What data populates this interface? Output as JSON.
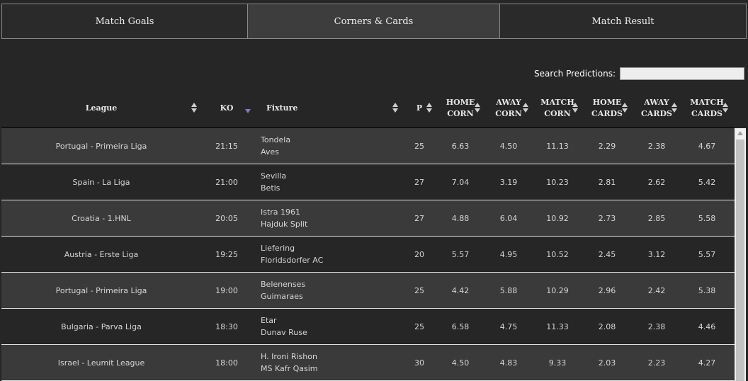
{
  "tabs": [
    {
      "label": "Match Goals",
      "active": false
    },
    {
      "label": "Corners & Cards",
      "active": true
    },
    {
      "label": "Match Result",
      "active": false
    }
  ],
  "search": {
    "label": "Search Predictions:",
    "value": ""
  },
  "columns": {
    "league": "League",
    "ko": "KO",
    "fixture": "Fixture",
    "p": "P",
    "home_corn_1": "HOME",
    "home_corn_2": "CORN",
    "away_corn_1": "AWAY",
    "away_corn_2": "CORN",
    "match_corn_1": "MATCH",
    "match_corn_2": "CORN",
    "home_cards_1": "HOME",
    "home_cards_2": "CARDS",
    "away_cards_1": "AWAY",
    "away_cards_2": "CARDS",
    "match_cards_1": "MATCH",
    "match_cards_2": "CARDS"
  },
  "rows": [
    {
      "league": "Portugal - Primeira Liga",
      "ko": "21:15",
      "home": "Tondela",
      "away": "Aves",
      "p": "25",
      "hc": "6.63",
      "ac": "4.50",
      "mc": "11.13",
      "hca": "2.29",
      "aca": "2.38",
      "mca": "4.67"
    },
    {
      "league": "Spain - La Liga",
      "ko": "21:00",
      "home": "Sevilla",
      "away": "Betis",
      "p": "27",
      "hc": "7.04",
      "ac": "3.19",
      "mc": "10.23",
      "hca": "2.81",
      "aca": "2.62",
      "mca": "5.42"
    },
    {
      "league": "Croatia - 1.HNL",
      "ko": "20:05",
      "home": "Istra 1961",
      "away": "Hajduk Split",
      "p": "27",
      "hc": "4.88",
      "ac": "6.04",
      "mc": "10.92",
      "hca": "2.73",
      "aca": "2.85",
      "mca": "5.58"
    },
    {
      "league": "Austria - Erste Liga",
      "ko": "19:25",
      "home": "Liefering",
      "away": "Floridsdorfer AC",
      "p": "20",
      "hc": "5.57",
      "ac": "4.95",
      "mc": "10.52",
      "hca": "2.45",
      "aca": "3.12",
      "mca": "5.57"
    },
    {
      "league": "Portugal - Primeira Liga",
      "ko": "19:00",
      "home": "Belenenses",
      "away": "Guimaraes",
      "p": "25",
      "hc": "4.42",
      "ac": "5.88",
      "mc": "10.29",
      "hca": "2.96",
      "aca": "2.42",
      "mca": "5.38"
    },
    {
      "league": "Bulgaria - Parva Liga",
      "ko": "18:30",
      "home": "Etar",
      "away": "Dunav Ruse",
      "p": "25",
      "hc": "6.58",
      "ac": "4.75",
      "mc": "11.33",
      "hca": "2.08",
      "aca": "2.38",
      "mca": "4.46"
    },
    {
      "league": "Israel - Leumit League",
      "ko": "18:00",
      "home": "H. Ironi Rishon",
      "away": "MS Kafr Qasim",
      "p": "30",
      "hc": "4.50",
      "ac": "4.83",
      "mc": "9.33",
      "hca": "2.03",
      "aca": "2.23",
      "mca": "4.27"
    }
  ]
}
